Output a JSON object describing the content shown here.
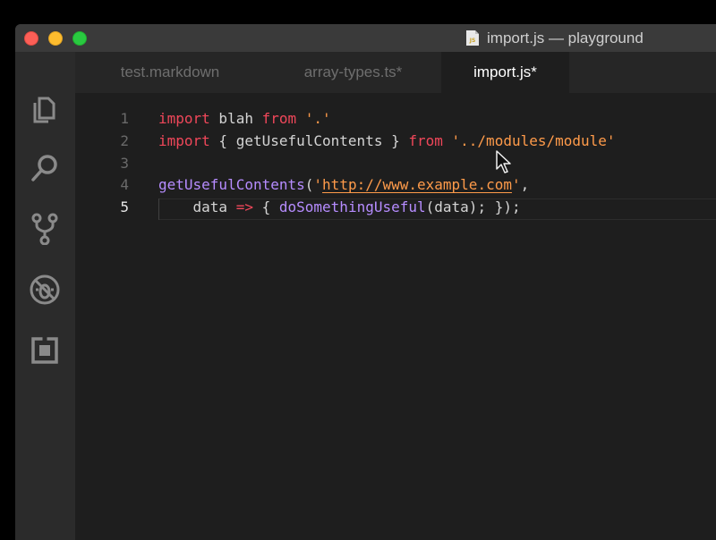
{
  "window": {
    "title": "import.js — playground",
    "file_icon_label": "JS"
  },
  "activity_bar": [
    {
      "name": "explorer-icon"
    },
    {
      "name": "search-icon"
    },
    {
      "name": "source-control-icon"
    },
    {
      "name": "debug-icon"
    },
    {
      "name": "extensions-icon"
    }
  ],
  "tabs": [
    {
      "label": "test.markdown",
      "active": false
    },
    {
      "label": "array-types.ts*",
      "active": false
    },
    {
      "label": "import.js*",
      "active": true
    }
  ],
  "editor": {
    "line_numbers": [
      "1",
      "2",
      "3",
      "4",
      "5"
    ],
    "current_line": "5",
    "lines": [
      [
        {
          "t": "import",
          "c": "kw"
        },
        {
          "t": " blah ",
          "c": "pl"
        },
        {
          "t": "from",
          "c": "kw"
        },
        {
          "t": " '.'",
          "c": "str"
        }
      ],
      [
        {
          "t": "import",
          "c": "kw"
        },
        {
          "t": " { getUsefulContents } ",
          "c": "pl"
        },
        {
          "t": "from",
          "c": "kw"
        },
        {
          "t": " '../modules/module'",
          "c": "str"
        }
      ],
      [],
      [
        {
          "t": "getUsefulContents",
          "c": "fn"
        },
        {
          "t": "(",
          "c": "pl"
        },
        {
          "t": "'",
          "c": "str"
        },
        {
          "t": "http://www.example.com",
          "c": "str link"
        },
        {
          "t": "'",
          "c": "str"
        },
        {
          "t": ",",
          "c": "pl"
        }
      ],
      [
        {
          "t": "    data ",
          "c": "pl"
        },
        {
          "t": "=>",
          "c": "kw"
        },
        {
          "t": " { ",
          "c": "pl"
        },
        {
          "t": "doSomethingUseful",
          "c": "fn"
        },
        {
          "t": "(data); });",
          "c": "pl"
        }
      ]
    ]
  },
  "colors": {
    "keyword": "#f0475a",
    "function": "#b68cff",
    "string": "#ff9b4a",
    "plain": "#d4d4d4"
  }
}
